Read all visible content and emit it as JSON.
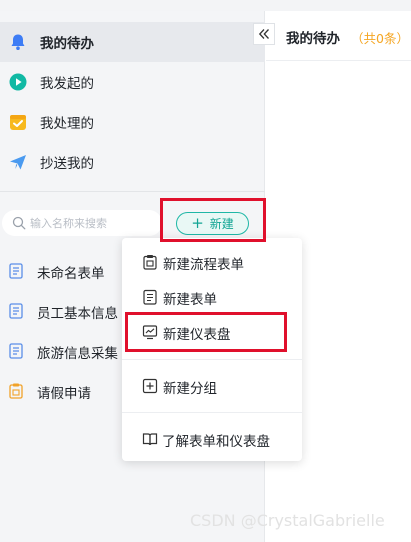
{
  "sidebar": {
    "nav": [
      {
        "label": "我的待办",
        "icon": "bell-icon",
        "active": true
      },
      {
        "label": "我发起的",
        "icon": "play-circle-icon",
        "active": false
      },
      {
        "label": "我处理的",
        "icon": "checkbox-icon",
        "active": false
      },
      {
        "label": "抄送我的",
        "icon": "paper-plane-icon",
        "active": false
      }
    ],
    "search_placeholder": "输入名称来搜索",
    "new_button_label": "新建",
    "forms": [
      {
        "label": "未命名表单",
        "icon": "form-doc-icon"
      },
      {
        "label": "员工基本信息",
        "icon": "form-doc-icon"
      },
      {
        "label": "旅游信息采集",
        "icon": "form-doc-icon"
      },
      {
        "label": "请假申请",
        "icon": "workflow-form-icon"
      }
    ]
  },
  "menu": {
    "items": [
      {
        "label": "新建流程表单",
        "icon": "workflow-form-icon"
      },
      {
        "label": "新建表单",
        "icon": "form-doc-icon"
      },
      {
        "label": "新建仪表盘",
        "icon": "dashboard-icon"
      },
      {
        "label": "新建分组",
        "icon": "add-group-icon"
      },
      {
        "label": "了解表单和仪表盘",
        "icon": "book-icon"
      }
    ]
  },
  "main": {
    "title": "我的待办",
    "count": "（共0条）"
  },
  "watermark": "CSDN @CrystalGabrielle",
  "colors": {
    "accent": "#12a594",
    "highlight": "#e0102c",
    "count": "#f5a623",
    "bell": "#3d7cf5",
    "play": "#11b9a4",
    "check": "#f7b91e",
    "plane": "#4a9af0",
    "leave": "#f1a22a"
  }
}
